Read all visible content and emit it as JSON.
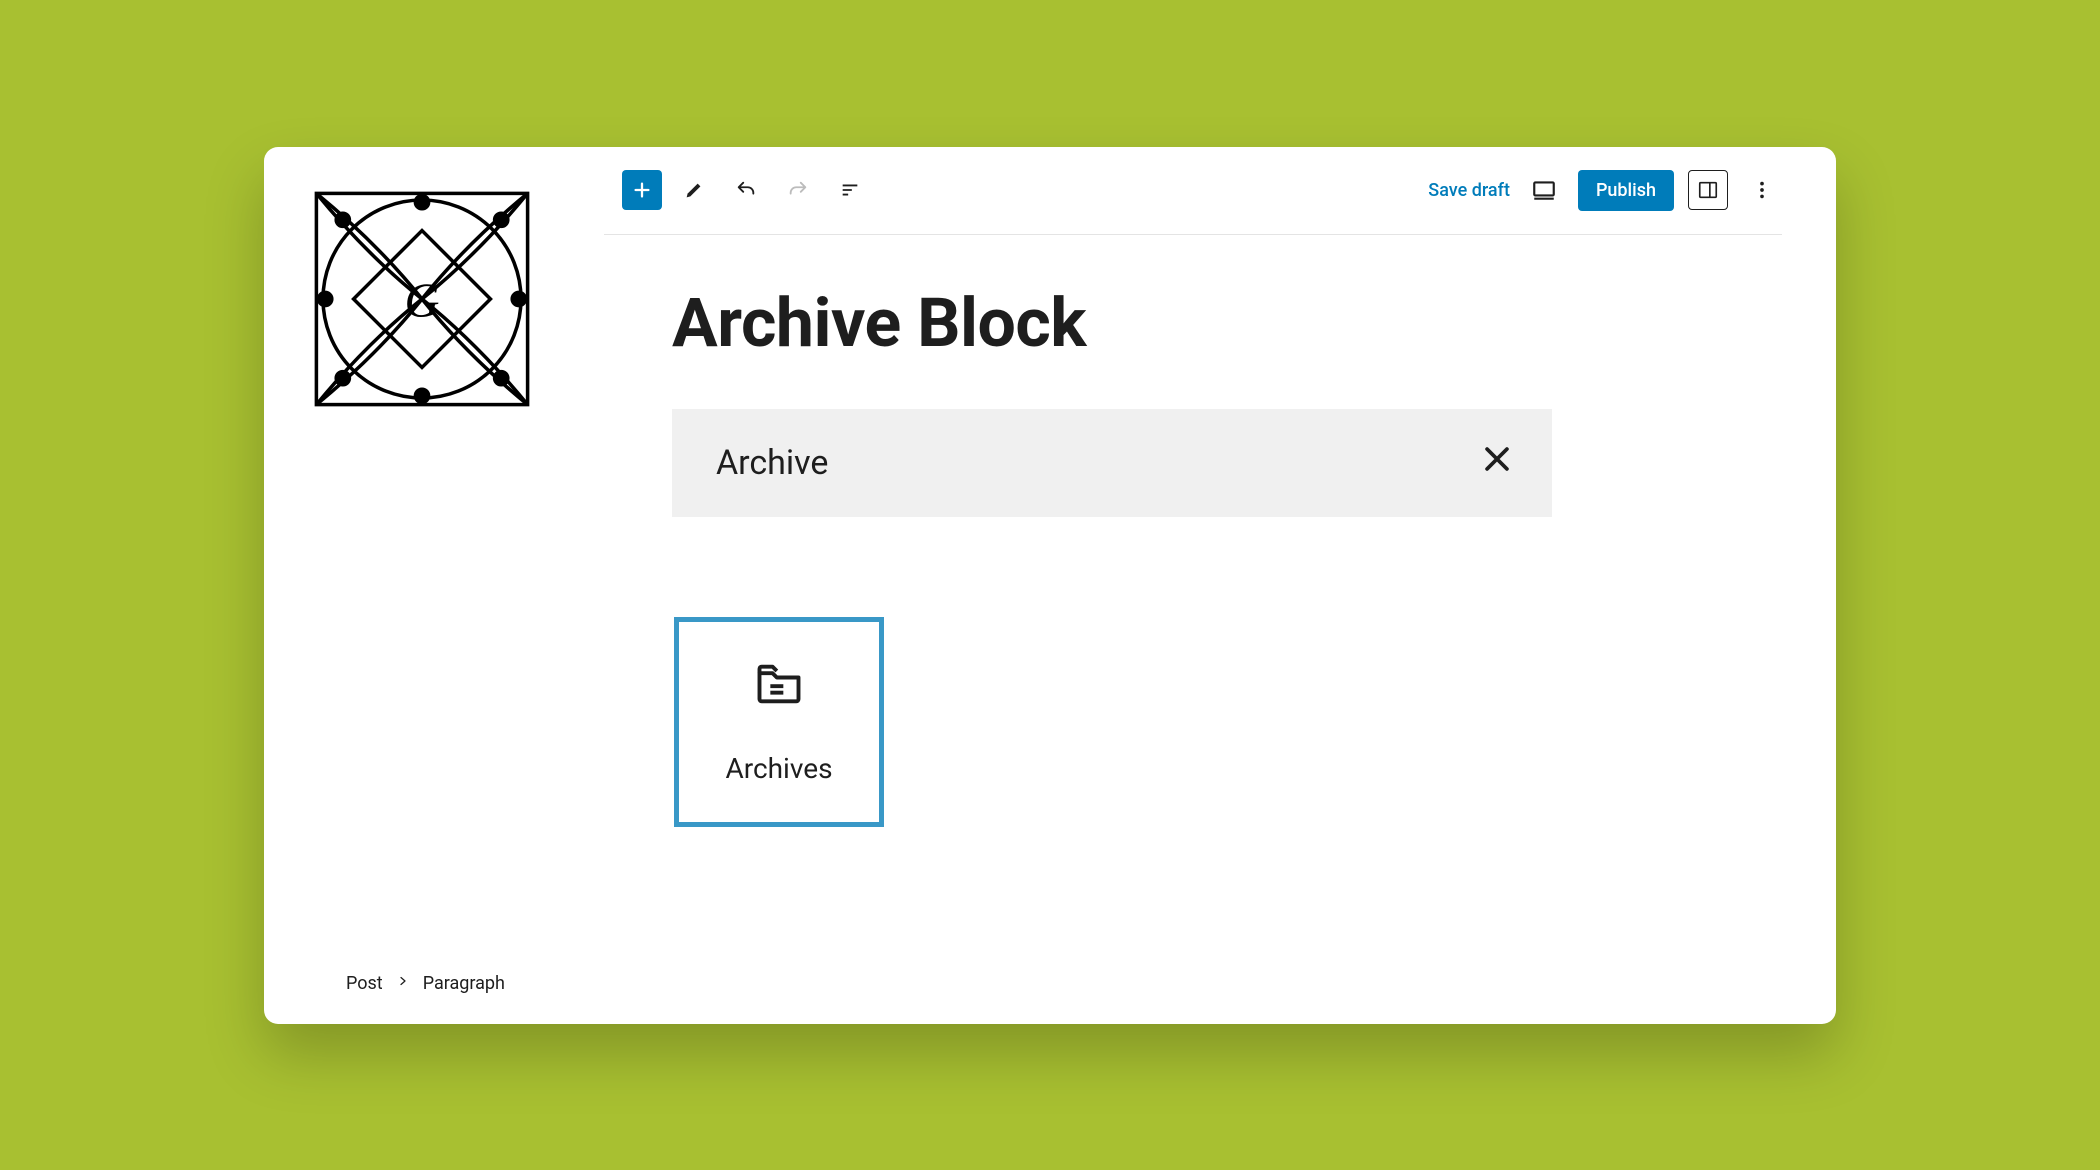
{
  "toolbar": {
    "save_draft": "Save draft",
    "publish": "Publish"
  },
  "page": {
    "title": "Archive Block"
  },
  "search": {
    "value": "Archive"
  },
  "block_result": {
    "label": "Archives"
  },
  "breadcrumb": {
    "root": "Post",
    "current": "Paragraph"
  }
}
